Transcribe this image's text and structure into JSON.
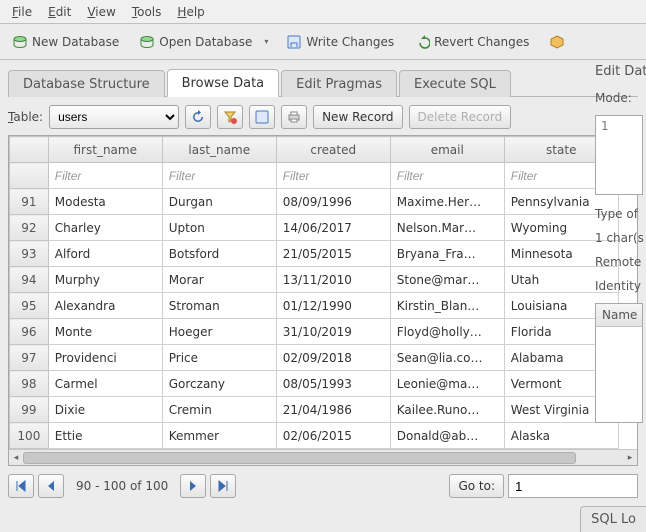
{
  "menubar": {
    "file": "File",
    "edit": "Edit",
    "view": "View",
    "tools": "Tools",
    "help": "Help"
  },
  "toolbar": {
    "new_db": "New Database",
    "open_db": "Open Database",
    "write_changes": "Write Changes",
    "revert_changes": "Revert Changes"
  },
  "tabs": {
    "structure": "Database Structure",
    "browse": "Browse Data",
    "pragmas": "Edit Pragmas",
    "sql": "Execute SQL"
  },
  "browse": {
    "table_label": "Table:",
    "table_selected": "users",
    "new_record": "New Record",
    "delete_record": "Delete Record",
    "columns": [
      "first_name",
      "last_name",
      "created",
      "email",
      "state"
    ],
    "filter_placeholder": "Filter",
    "rows": [
      {
        "n": "91",
        "first_name": "Modesta",
        "last_name": "Durgan",
        "created": "08/09/1996",
        "email": "Maxime.Her…",
        "state": "Pennsylvania"
      },
      {
        "n": "92",
        "first_name": "Charley",
        "last_name": "Upton",
        "created": "14/06/2017",
        "email": "Nelson.Mar…",
        "state": "Wyoming"
      },
      {
        "n": "93",
        "first_name": "Alford",
        "last_name": "Botsford",
        "created": "21/05/2015",
        "email": "Bryana_Fra…",
        "state": "Minnesota"
      },
      {
        "n": "94",
        "first_name": "Murphy",
        "last_name": "Morar",
        "created": "13/11/2010",
        "email": "Stone@mar…",
        "state": "Utah"
      },
      {
        "n": "95",
        "first_name": "Alexandra",
        "last_name": "Stroman",
        "created": "01/12/1990",
        "email": "Kirstin_Blan…",
        "state": "Louisiana"
      },
      {
        "n": "96",
        "first_name": "Monte",
        "last_name": "Hoeger",
        "created": "31/10/2019",
        "email": "Floyd@holly…",
        "state": "Florida"
      },
      {
        "n": "97",
        "first_name": "Providenci",
        "last_name": "Price",
        "created": "02/09/2018",
        "email": "Sean@lia.co…",
        "state": "Alabama"
      },
      {
        "n": "98",
        "first_name": "Carmel",
        "last_name": "Gorczany",
        "created": "08/05/1993",
        "email": "Leonie@ma…",
        "state": "Vermont"
      },
      {
        "n": "99",
        "first_name": "Dixie",
        "last_name": "Cremin",
        "created": "21/04/1986",
        "email": "Kailee.Runo…",
        "state": "West Virginia"
      },
      {
        "n": "100",
        "first_name": "Ettie",
        "last_name": "Kemmer",
        "created": "02/06/2015",
        "email": "Donald@ab…",
        "state": "Alaska"
      }
    ],
    "pager": {
      "range": "90 - 100 of 100",
      "goto": "Go to:",
      "goto_value": "1"
    }
  },
  "editpane": {
    "title": "Edit Data",
    "mode_label": "Mode:",
    "cell_preview": "1",
    "type_of": "Type of",
    "chars": "1 char(s",
    "remote": "Remote",
    "identity": "Identity",
    "name_header": "Name"
  },
  "sql_log_tab": "SQL Lo"
}
